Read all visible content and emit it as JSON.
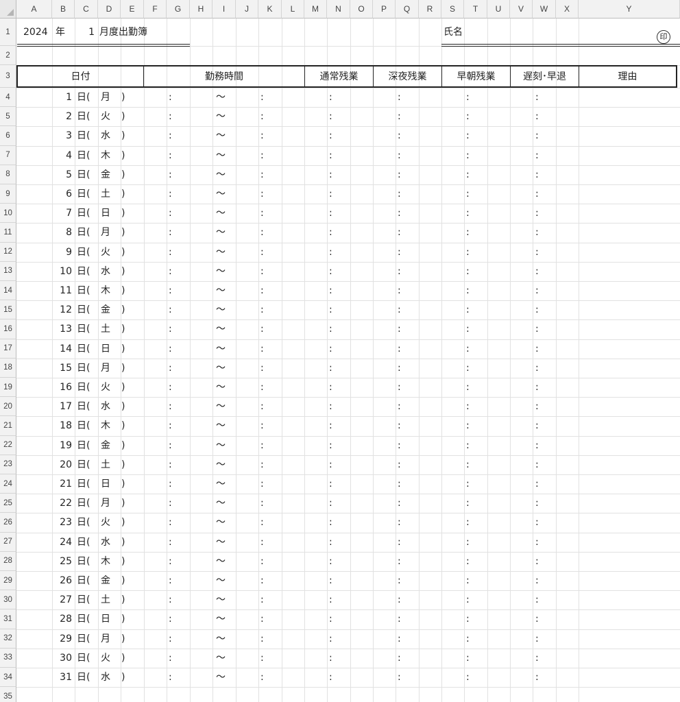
{
  "columns": [
    "A",
    "B",
    "C",
    "D",
    "E",
    "F",
    "G",
    "H",
    "I",
    "J",
    "K",
    "L",
    "M",
    "N",
    "O",
    "P",
    "Q",
    "R",
    "S",
    "T",
    "U",
    "V",
    "W",
    "X",
    "Y"
  ],
  "row_numbers": [
    "1",
    "2",
    "3",
    "4",
    "5",
    "6",
    "7",
    "8",
    "9",
    "10",
    "11",
    "12",
    "13",
    "14",
    "15",
    "16",
    "17",
    "18",
    "19",
    "20",
    "21",
    "22",
    "23",
    "24",
    "25",
    "26",
    "27",
    "28",
    "29",
    "30",
    "31",
    "32",
    "33",
    "34",
    "35"
  ],
  "title": {
    "year": "2024",
    "year_unit": "年",
    "month": "1",
    "month_suffix": "月度出勤簿",
    "name_label": "氏名",
    "seal_mark": "印"
  },
  "table_headers": {
    "date": "日付",
    "work_hours": "勤務時間",
    "normal_overtime": "通常残業",
    "night_overtime": "深夜残業",
    "early_overtime": "早朝残業",
    "late_early_leave": "遅刻･早退",
    "reason": "理由"
  },
  "row_template": {
    "day_suffix": "日(",
    "close_paren": ")",
    "time_sep": ":",
    "range_sep": "〜"
  },
  "days": [
    {
      "day": "1",
      "weekday": "月"
    },
    {
      "day": "2",
      "weekday": "火"
    },
    {
      "day": "3",
      "weekday": "水"
    },
    {
      "day": "4",
      "weekday": "木"
    },
    {
      "day": "5",
      "weekday": "金"
    },
    {
      "day": "6",
      "weekday": "土"
    },
    {
      "day": "7",
      "weekday": "日"
    },
    {
      "day": "8",
      "weekday": "月"
    },
    {
      "day": "9",
      "weekday": "火"
    },
    {
      "day": "10",
      "weekday": "水"
    },
    {
      "day": "11",
      "weekday": "木"
    },
    {
      "day": "12",
      "weekday": "金"
    },
    {
      "day": "13",
      "weekday": "土"
    },
    {
      "day": "14",
      "weekday": "日"
    },
    {
      "day": "15",
      "weekday": "月"
    },
    {
      "day": "16",
      "weekday": "火"
    },
    {
      "day": "17",
      "weekday": "水"
    },
    {
      "day": "18",
      "weekday": "木"
    },
    {
      "day": "19",
      "weekday": "金"
    },
    {
      "day": "20",
      "weekday": "土"
    },
    {
      "day": "21",
      "weekday": "日"
    },
    {
      "day": "22",
      "weekday": "月"
    },
    {
      "day": "23",
      "weekday": "火"
    },
    {
      "day": "24",
      "weekday": "水"
    },
    {
      "day": "25",
      "weekday": "木"
    },
    {
      "day": "26",
      "weekday": "金"
    },
    {
      "day": "27",
      "weekday": "土"
    },
    {
      "day": "28",
      "weekday": "日"
    },
    {
      "day": "29",
      "weekday": "月"
    },
    {
      "day": "30",
      "weekday": "火"
    },
    {
      "day": "31",
      "weekday": "水"
    }
  ]
}
